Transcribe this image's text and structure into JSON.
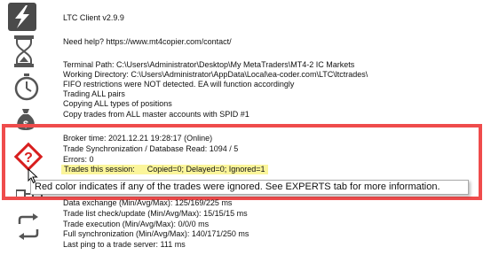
{
  "header": {
    "title": "LTC Client v2.9.9",
    "help": "Need help? https://www.mt4copier.com/contact/"
  },
  "info": [
    "Terminal Path: C:\\Users\\Administrator\\Desktop\\My MetaTraders\\MT4-2 IC Markets",
    "Working Directory: C:\\Users\\Administrator\\AppData\\Local\\ea-coder.com\\LTC\\ltctrades\\",
    "FIFO restrictions were NOT detected. EA will function accordingly",
    "Trading ALL pairs",
    "Copying ALL types of positions",
    "Copy trades from ALL master accounts with SPID #1"
  ],
  "status": {
    "broker_time": "Broker time: 2021.12.21 19:28:17 (Online)",
    "sync": "Trade Synchronization / Database Read: 1094 / 5",
    "errors": "Errors: 0",
    "session_label": "Trades this session:",
    "session_values": "Copied=0; Delayed=0; Ignored=1"
  },
  "tooltip": "Red color indicates if any of the trades were ignored. See EXPERTS tab for more information.",
  "stats": [
    "Data exchange (Min/Avg/Max): 125/169/225 ms",
    "Trade list check/update (Min/Avg/Max): 15/15/15 ms",
    "Trade execution (Min/Avg/Max): 0/0/0 ms",
    "Full synchronization (Min/Avg/Max): 140/171/250 ms",
    "Last ping to a trade server: 111 ms"
  ],
  "icons": {
    "logo": "lightning-logo-icon",
    "hourglass": "hourglass-icon",
    "clock": "clock-icon",
    "money": "money-bag-icon",
    "warning": "warning-question-icon",
    "network": "network-icon",
    "sync": "sync-icon"
  },
  "colors": {
    "highlight": "#fbf59a",
    "frame": "#ef4c4c",
    "warning": "#d81e1e",
    "icon": "#555555"
  }
}
